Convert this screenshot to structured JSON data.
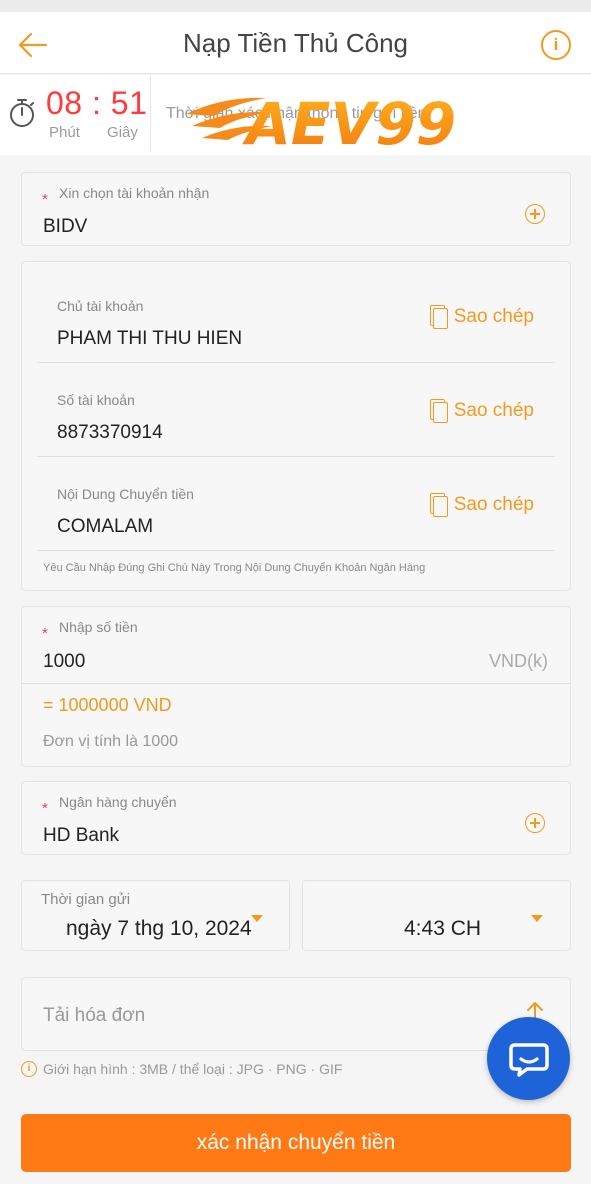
{
  "header": {
    "title": "Nạp Tiền Thủ Công",
    "info_symbol": "i"
  },
  "timer": {
    "minutes": "08",
    "separator": ":",
    "seconds": "51",
    "minutes_label": "Phút",
    "seconds_label": "Giây",
    "note": "Thời gian xác nhận thông tin gửi tiền"
  },
  "logo": {
    "text": "AEV99",
    "colors": {
      "primary": "#f39a1e",
      "secondary": "#ffb21e"
    }
  },
  "receive_account": {
    "label": "Xin chọn tài khoản nhận",
    "value": "BIDV",
    "required_mark": "*"
  },
  "account_details": {
    "fields": [
      {
        "label": "Chủ tài khoản",
        "value": "PHAM THI THU HIEN",
        "copy_label": "Sao chép"
      },
      {
        "label": "Số tài khoản",
        "value": "8873370914",
        "copy_label": "Sao chép"
      },
      {
        "label": "Nội Dung Chuyển tiền",
        "value": "COMALAM",
        "copy_label": "Sao chép"
      }
    ],
    "note": "Yêu Cầu Nhập Đúng Ghi Chú Này Trong Nội Dung Chuyển Khoản Ngân Hàng"
  },
  "amount": {
    "label": "Nhập số tiền",
    "required_mark": "*",
    "value": "1000",
    "unit": "VND(k)",
    "converted": "= 1000000 VND",
    "hint": "Đơn vị tính là 1000"
  },
  "sending_bank": {
    "label": "Ngân hàng chuyển",
    "required_mark": "*",
    "value": "HD Bank"
  },
  "send_time": {
    "label": "Thời gian gửi",
    "date": "ngày 7 thg 10, 2024",
    "time": "4:43 CH"
  },
  "upload": {
    "placeholder": "Tải hóa đơn",
    "limit": "Giới hạn hình : 3MB / thể loại : JPG · PNG · GIF"
  },
  "submit": {
    "label": "xác nhận chuyển tiền"
  },
  "colors": {
    "accent": "#f39a1e",
    "button": "#ff7a15",
    "timer": "#ff3b3b",
    "chat": "#1e63d8"
  }
}
